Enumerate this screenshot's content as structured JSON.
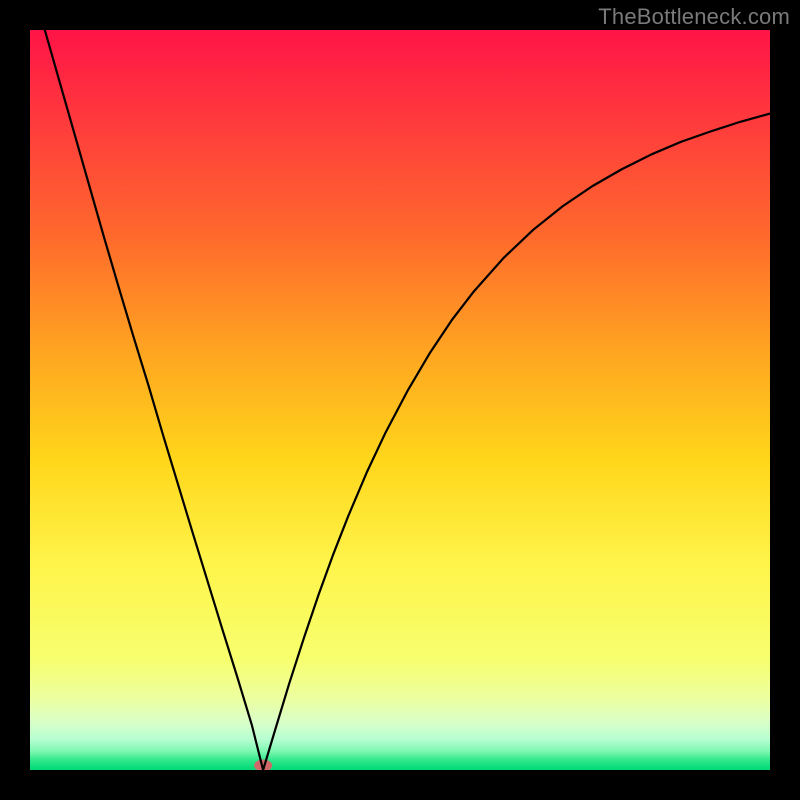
{
  "watermark": "TheBottleneck.com",
  "chart_data": {
    "type": "line",
    "title": "",
    "xlabel": "",
    "ylabel": "",
    "xlim": [
      0,
      1
    ],
    "ylim": [
      0,
      1
    ],
    "x_min_at": 0.315,
    "gradient_stops": [
      {
        "offset": 0.0,
        "color": "#ff1447"
      },
      {
        "offset": 0.13,
        "color": "#ff3c3c"
      },
      {
        "offset": 0.28,
        "color": "#ff6a2c"
      },
      {
        "offset": 0.43,
        "color": "#ffa321"
      },
      {
        "offset": 0.58,
        "color": "#ffd61a"
      },
      {
        "offset": 0.72,
        "color": "#fff44a"
      },
      {
        "offset": 0.85,
        "color": "#f7ff6e"
      },
      {
        "offset": 0.905,
        "color": "#ecffa2"
      },
      {
        "offset": 0.935,
        "color": "#d9ffc8"
      },
      {
        "offset": 0.958,
        "color": "#b8ffd2"
      },
      {
        "offset": 0.975,
        "color": "#7cf7b0"
      },
      {
        "offset": 0.987,
        "color": "#2de88b"
      },
      {
        "offset": 1.0,
        "color": "#00d977"
      }
    ],
    "marker": {
      "x": 0.315,
      "y": 0.006,
      "color": "#d06a6a",
      "rx": 9,
      "ry": 6
    },
    "series": [
      {
        "name": "bottleneck-curve",
        "color": "#000000",
        "stroke_width": 2.2,
        "x": [
          0.0,
          0.02,
          0.04,
          0.06,
          0.08,
          0.1,
          0.12,
          0.14,
          0.16,
          0.18,
          0.2,
          0.22,
          0.24,
          0.26,
          0.28,
          0.3,
          0.315,
          0.33,
          0.35,
          0.37,
          0.39,
          0.41,
          0.43,
          0.455,
          0.48,
          0.51,
          0.54,
          0.57,
          0.6,
          0.64,
          0.68,
          0.72,
          0.76,
          0.8,
          0.84,
          0.88,
          0.92,
          0.96,
          1.0
        ],
        "y": [
          null,
          1.0,
          0.93,
          0.86,
          0.79,
          0.72,
          0.652,
          0.585,
          0.52,
          0.452,
          0.386,
          0.32,
          0.255,
          0.19,
          0.126,
          0.06,
          0.0,
          0.05,
          0.116,
          0.178,
          0.237,
          0.292,
          0.343,
          0.402,
          0.455,
          0.512,
          0.563,
          0.608,
          0.647,
          0.692,
          0.73,
          0.762,
          0.789,
          0.812,
          0.832,
          0.849,
          0.863,
          0.876,
          0.887
        ]
      }
    ]
  }
}
